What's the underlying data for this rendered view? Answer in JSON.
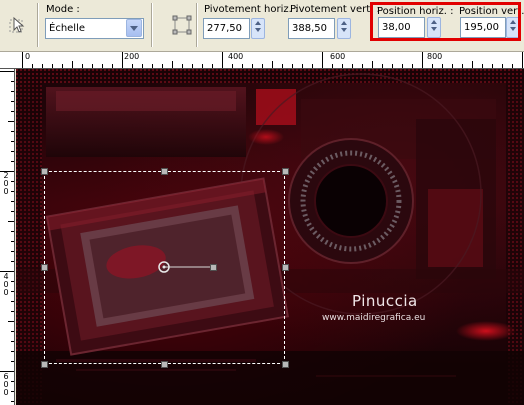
{
  "toolbar": {
    "mode": {
      "label": "Mode :",
      "value": "Échelle"
    },
    "pivot_h": {
      "label": "Pivotement horiz. :",
      "value": "277,50"
    },
    "pivot_v": {
      "label": "Pivotement vert. :",
      "value": "388,50"
    },
    "pos_h": {
      "label": "Position horiz. :",
      "value": "38,00"
    },
    "pos_v": {
      "label": "Position vert. :",
      "value": "195,00"
    },
    "highlight_color": "#e10000"
  },
  "ruler_h": {
    "labels": [
      "0",
      "200",
      "400",
      "600",
      "800"
    ]
  },
  "ruler_v": {
    "labels": [
      "200",
      "400",
      "600"
    ]
  },
  "canvas": {
    "watermark_title": "Pinuccia",
    "watermark_url": "www.maidiregrafica.eu"
  }
}
